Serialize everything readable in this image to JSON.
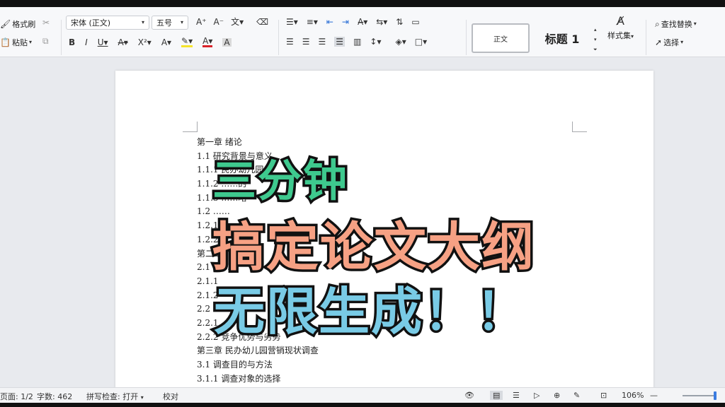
{
  "ribbon": {
    "format_painter": "格式刷",
    "paste": "粘贴",
    "font_name": "宋体 (正文)",
    "font_size": "五号",
    "style_normal": "正文",
    "style_heading": "标题 1",
    "styles_set": "样式集",
    "find_replace": "查找替换",
    "select": "选择"
  },
  "document": {
    "lines": [
      "第一章  绪论",
      "1.1  研究背景与意义",
      "1.1.1  民办幼儿园",
      "1.1.2  ……的",
      "1.1.3  ……略",
      "1.2  ……",
      "1.2.1",
      "1.2.2",
      "第二章",
      "2.1  ……",
      "2.1.1",
      "2.1.2",
      "2.2",
      "2.2.1",
      "2.2.2  竞争优势与劣势",
      "第三章  民办幼儿园营销现状调查",
      "3.1  调查目的与方法",
      "3.1.1  调查对象的选择"
    ]
  },
  "overlay": {
    "line1": "三分钟",
    "line2": "搞定论文大纲",
    "line3": "无限生成！！",
    "colors": {
      "line1": "#3ec98e",
      "line2": "#f6a184",
      "line3": "#79cbe6",
      "stroke": "#111111"
    }
  },
  "status": {
    "page": "页面: 1/2",
    "word_count": "字数: 462",
    "spell_check": "拼写检查: 打开",
    "proofread": "校对",
    "zoom": "106%"
  }
}
